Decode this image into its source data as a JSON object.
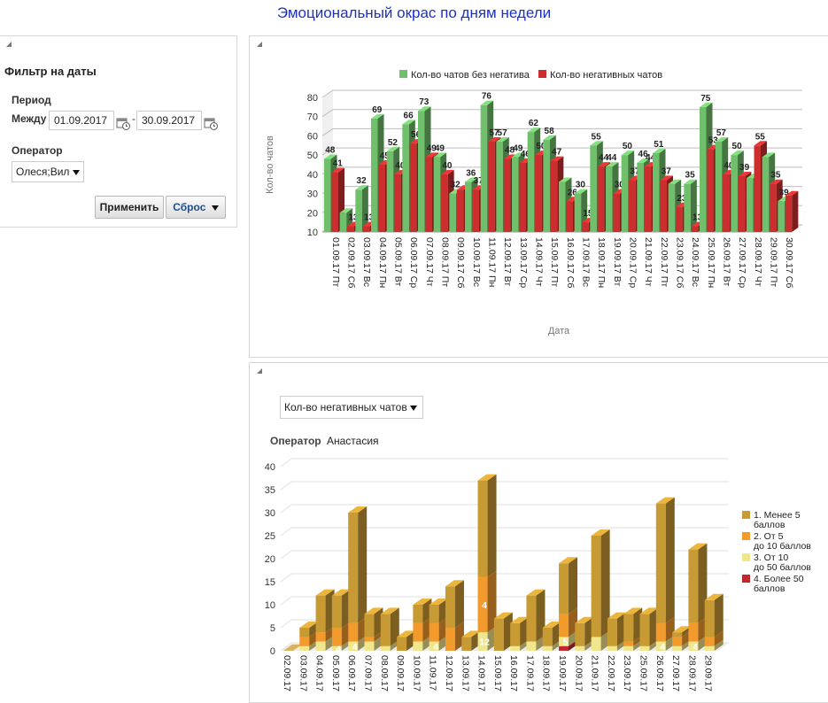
{
  "page": {
    "title": "Эмоциональный окрас по дням недели"
  },
  "filter": {
    "title": "Фильтр на даты",
    "period_label": "Период",
    "between_label": "Между",
    "date_from": "01.09.2017",
    "dash": "-",
    "date_to": "30.09.2017",
    "operator_label": "Оператор",
    "operator_value": "Олеся;Вил",
    "apply_label": "Применить",
    "reset_label": "Сброс"
  },
  "chart2_controls": {
    "measure_select": "Кол-во негативных чатов",
    "operator_label": "Оператор",
    "operator_value": "Анастасия"
  },
  "colors": {
    "title": "#1a31c8",
    "green": "#6fbf6b",
    "red": "#cc2e2e",
    "gold": "#c89a34",
    "orange": "#f29a2c",
    "lightyellow": "#f0e68c",
    "darkred": "#c0282c"
  },
  "chart_data": [
    {
      "type": "bar",
      "subtype": "3d-grouped",
      "ylabel": "Кол-во чатов",
      "xlabel": "Дата",
      "ylim": [
        10,
        80
      ],
      "yticks": [
        10,
        20,
        30,
        40,
        50,
        60,
        70,
        80
      ],
      "legend_position": "top",
      "categories": [
        "01.09.17 Пт",
        "02.09.17 Сб",
        "03.09.17 Вс",
        "04.09.17 Пн",
        "05.09.17 Вт",
        "06.09.17 Ср",
        "07.09.17 Чт",
        "08.09.17 Пт",
        "09.09.17 Сб",
        "10.09.17 Вс",
        "11.09.17 Пн",
        "12.09.17 Вт",
        "13.09.17 Ср",
        "14.09.17 Чт",
        "15.09.17 Пт",
        "16.09.17 Сб",
        "17.09.17 Вс",
        "18.09.17 Пн",
        "19.09.17 Вт",
        "20.09.17 Ср",
        "21.09.17 Чт",
        "22.09.17 Пт",
        "23.09.17 Сб",
        "24.09.17 Вс",
        "25.09.17 Пн",
        "26.09.17 Вт",
        "27.09.17 Ср",
        "28.09.17 Чт",
        "29.09.17 Пт",
        "30.09.17 Сб"
      ],
      "series": [
        {
          "name": "Кол-во чатов без негатива",
          "color": "#6fbf6b",
          "values": [
            48,
            20,
            32,
            69,
            52,
            66,
            73,
            49,
            30,
            36,
            76,
            57,
            49,
            62,
            58,
            36,
            30,
            55,
            44,
            50,
            46,
            51,
            35,
            35,
            75,
            57,
            50,
            38,
            49,
            26
          ]
        },
        {
          "name": "Кол-во негативных чатов",
          "color": "#cc2e2e",
          "values": [
            41,
            13,
            13,
            45,
            40,
            56,
            49,
            40,
            32,
            32,
            57,
            48,
            46,
            50,
            47,
            26,
            15,
            44,
            30,
            37,
            44,
            37,
            23,
            13,
            53,
            40,
            39,
            55,
            35,
            29
          ]
        }
      ],
      "value_labels": [
        [
          "48",
          "",
          "32",
          "69",
          "52",
          "66",
          "73",
          "49",
          "32",
          "36",
          "76",
          "57",
          "49",
          "62",
          "58",
          "",
          "30",
          "55",
          "44",
          "50",
          "46",
          "51",
          "",
          "35",
          "75",
          "57",
          "50",
          "",
          "",
          "39"
        ],
        [
          "41",
          "13",
          "13",
          "45",
          "40",
          "56",
          "49",
          "40",
          "",
          "37",
          "57",
          "48",
          "46",
          "50",
          "47",
          "26",
          "15",
          "44",
          "30",
          "37",
          "44",
          "37",
          "23",
          "13",
          "53",
          "40",
          "39",
          "55",
          "35",
          ""
        ]
      ]
    },
    {
      "type": "bar",
      "subtype": "3d-stacked",
      "ylim": [
        0,
        40
      ],
      "yticks": [
        0,
        5,
        10,
        15,
        20,
        25,
        30,
        35,
        40
      ],
      "legend_position": "right",
      "categories": [
        "02.09.17",
        "03.09.17",
        "04.09.17",
        "05.09.17",
        "06.09.17",
        "07.09.17",
        "08.09.17",
        "09.09.17",
        "10.09.17",
        "11.09.17",
        "12.09.17",
        "13.09.17",
        "14.09.17",
        "15.09.17",
        "16.09.17",
        "17.09.17",
        "18.09.17",
        "19.09.17",
        "20.09.17",
        "21.09.17",
        "22.09.17",
        "23.09.17",
        "25.09.17",
        "26.09.17",
        "27.09.17",
        "28.09.17",
        "29.09.17"
      ],
      "series": [
        {
          "name": "1. Менее 5 баллов",
          "color": "#c89a34",
          "values": [
            0,
            2,
            8,
            7,
            24,
            5,
            7,
            3,
            4,
            4,
            9,
            3,
            21,
            7,
            5,
            10,
            4,
            11,
            5,
            22,
            6,
            6,
            7,
            26,
            1,
            16,
            8
          ]
        },
        {
          "name": "2. От 5 до 10 баллов",
          "color": "#f29a2c",
          "values": [
            0,
            2,
            2,
            4,
            4,
            1,
            0,
            0,
            4,
            4,
            5,
            0,
            12,
            0,
            0,
            0,
            0,
            5,
            0,
            0,
            0,
            1,
            0,
            4,
            2,
            4,
            2
          ]
        },
        {
          "name": "3. От 10 до 50 баллов",
          "color": "#f0e68c",
          "values": [
            0,
            1,
            2,
            1,
            2,
            2,
            1,
            0,
            2,
            2,
            0,
            0,
            4,
            0,
            1,
            2,
            1,
            2,
            1,
            3,
            1,
            1,
            1,
            2,
            1,
            2,
            1
          ]
        },
        {
          "name": "4. Более 50 баллов",
          "color": "#c0282c",
          "values": [
            0,
            0,
            0,
            0,
            0,
            0,
            0,
            0,
            0,
            0,
            0,
            0,
            0,
            0,
            0,
            0,
            0,
            1,
            0,
            0,
            0,
            0,
            0,
            0,
            0,
            0,
            0
          ]
        }
      ],
      "value_labels": [
        [
          "",
          "",
          "8",
          "7",
          "24",
          "",
          "7",
          "",
          "4",
          "4",
          "9",
          "",
          "21",
          "7",
          "5",
          "10",
          "4",
          "11",
          "5",
          "22",
          "6",
          "6",
          "7",
          "26",
          "",
          "16",
          "8"
        ],
        [
          "",
          "",
          "",
          "4",
          "4",
          "",
          "",
          "",
          "",
          "4",
          "5",
          "",
          "12",
          "",
          "",
          "",
          "",
          "5",
          "",
          "",
          "",
          "",
          "",
          "4",
          "",
          "4",
          ""
        ],
        [
          "",
          "",
          "",
          "",
          "",
          "",
          "",
          "",
          "",
          "",
          "",
          "",
          "4",
          "",
          "",
          "",
          "",
          "",
          "",
          "",
          "",
          "",
          "",
          "",
          "",
          "",
          ""
        ]
      ]
    }
  ]
}
